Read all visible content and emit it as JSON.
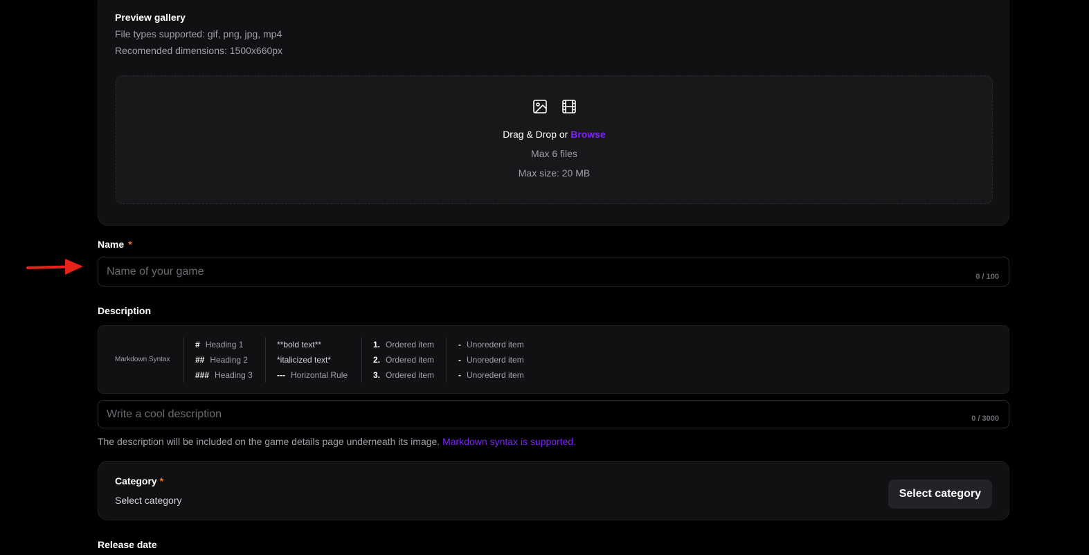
{
  "gallery": {
    "title": "Preview gallery",
    "file_types": "File types supported: gif, png, jpg, mp4",
    "dimensions": "Recomended dimensions: 1500x660px",
    "dropzone": {
      "prompt": "Drag & Drop or ",
      "browse": "Browse",
      "max_files": "Max 6 files",
      "max_size": "Max size: 20 MB",
      "icons": [
        "image-icon",
        "film-icon"
      ]
    }
  },
  "name_field": {
    "label": "Name",
    "required_mark": "*",
    "placeholder": "Name of your game",
    "counter": "0 / 100"
  },
  "description": {
    "label": "Description",
    "markdown": {
      "title": "Markdown Syntax",
      "headings": [
        {
          "mark": "#",
          "text": "Heading 1"
        },
        {
          "mark": "##",
          "text": "Heading 2"
        },
        {
          "mark": "###",
          "text": "Heading 3"
        }
      ],
      "formatting": [
        {
          "text": "**bold text**"
        },
        {
          "text": "*italicized text*"
        },
        {
          "mark": "---",
          "text": "Horizontal Rule"
        }
      ],
      "ordered": [
        {
          "mark": "1.",
          "text": "Ordered item"
        },
        {
          "mark": "2.",
          "text": "Ordered item"
        },
        {
          "mark": "3.",
          "text": "Ordered item"
        }
      ],
      "unordered": [
        {
          "mark": "-",
          "text": "Unorederd item"
        },
        {
          "mark": "-",
          "text": "Unorederd item"
        },
        {
          "mark": "-",
          "text": "Unorederd item"
        }
      ]
    },
    "placeholder": "Write a cool description",
    "counter": "0 / 3000",
    "helper_text": "The description will be included on the game details page underneath its image. ",
    "helper_link": "Markdown syntax is supported."
  },
  "category": {
    "label": "Category",
    "required_mark": "*",
    "value": "Select category",
    "button_label": "Select category"
  },
  "release_date": {
    "label": "Release date"
  },
  "colors": {
    "accent": "#7c22ff",
    "required": "#f97316",
    "arrow": "#e5231b"
  }
}
